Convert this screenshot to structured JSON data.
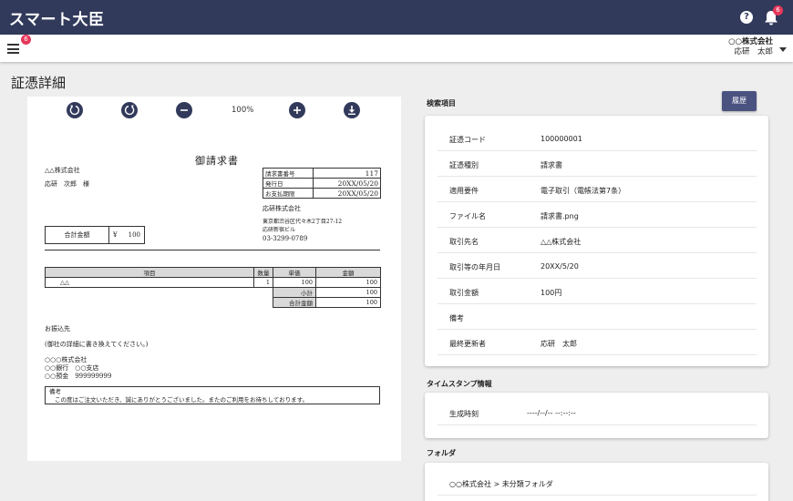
{
  "app": {
    "brand": "スマート大臣",
    "help_icon": "help-circle-icon",
    "help_glyph": "?",
    "notifications_count": "6",
    "menu_badge_count": "6"
  },
  "account": {
    "company": "○○株式会社",
    "user": "応研　太郎"
  },
  "page": {
    "title": "証憑詳細"
  },
  "viewer": {
    "zoom": "100%",
    "tools": [
      "rotate-left-icon",
      "rotate-right-icon",
      "zoom-out-icon",
      "zoom-in-icon",
      "download-icon"
    ]
  },
  "document": {
    "title": "御請求書",
    "recipient_company": "△△株式会社",
    "recipient_person": "応研　次郎　様",
    "meta": [
      {
        "label": "請求書番号",
        "value": "117"
      },
      {
        "label": "発行日",
        "value": "20XX/05/20"
      },
      {
        "label": "お支払期限",
        "value": "20XX/05/20"
      }
    ],
    "issuer_company": "応研株式会社",
    "issuer_address1": "東京都渋谷区代々木2丁目27-12",
    "issuer_address2": "応研新宿ビル",
    "issuer_phone": "03-3299-0789",
    "total_label": "合計金額",
    "total_currency": "¥",
    "total_value": "100",
    "items_headers": [
      "項目",
      "数量",
      "単価",
      "金額"
    ],
    "items": [
      {
        "name": "△△",
        "qty": "1",
        "price": "100",
        "amount": "100"
      }
    ],
    "subtotal_label": "小計",
    "subtotal_value": "100",
    "grand_total_label": "合計金額",
    "grand_total_value": "100",
    "payee_heading": "お振込先",
    "payee_note": "(御社の詳細に書き換えてください。)",
    "payee_company": "○○○株式会社",
    "payee_bank": "○○銀行　○○支店",
    "payee_account": "○○預金　999999999",
    "remarks_label": "備考",
    "remarks_text": "この度はご注文いただき、誠にありがとうございました。またのご利用をお待ちしております。"
  },
  "search_section": {
    "label": "検索項目",
    "history_button": "履歴",
    "fields": [
      {
        "key": "証憑コード",
        "value": "100000001"
      },
      {
        "key": "証憑種別",
        "value": "請求書"
      },
      {
        "key": "適用要件",
        "value": "電子取引（電帳法第7条）"
      },
      {
        "key": "ファイル名",
        "value": "請求書.png"
      },
      {
        "key": "取引先名",
        "value": "△△株式会社"
      },
      {
        "key": "取引等の年月日",
        "value": "20XX/5/20"
      },
      {
        "key": "取引金額",
        "value": "100円"
      },
      {
        "key": "備考",
        "value": ""
      },
      {
        "key": "最終更新者",
        "value": "応研　太郎"
      }
    ]
  },
  "timestamp_section": {
    "label": "タイムスタンプ情報",
    "key": "生成時刻",
    "value": "----/--/-- --:--:--"
  },
  "folder_section": {
    "label": "フォルダ",
    "path": "○○株式会社 > 未分類フォルダ"
  }
}
